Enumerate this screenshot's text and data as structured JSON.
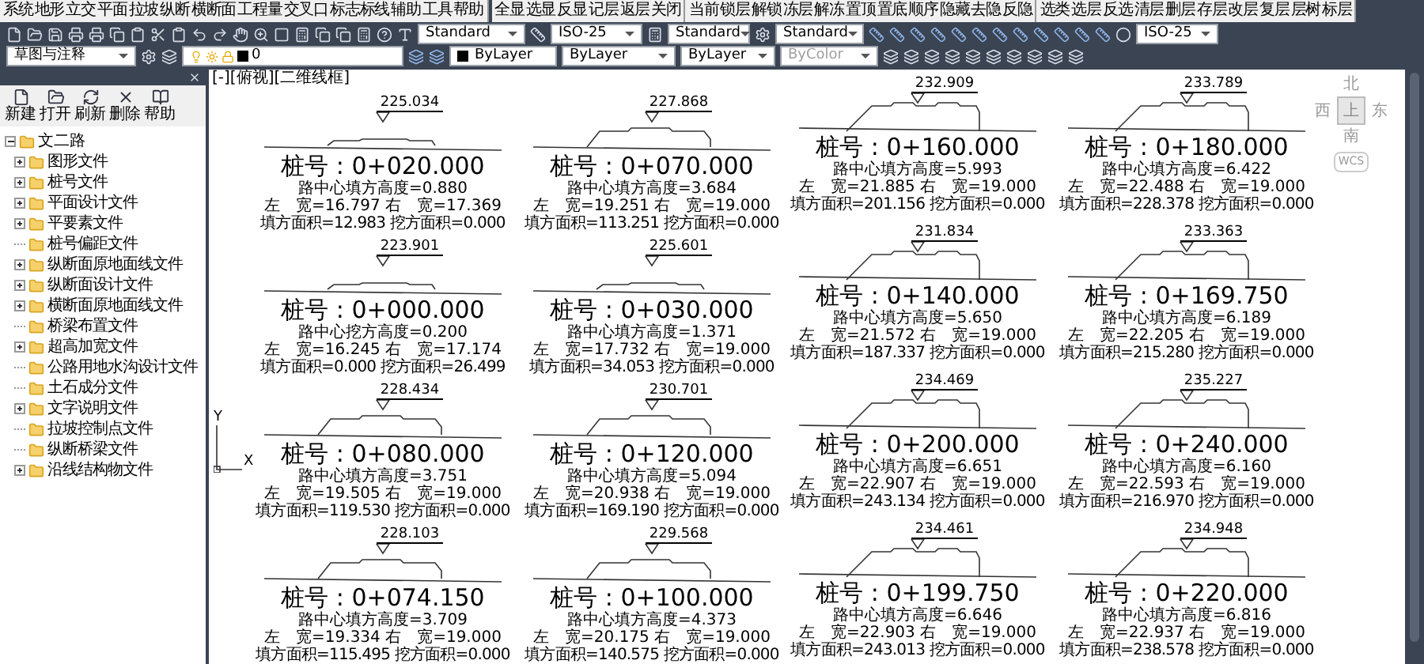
{
  "menu_groups": [
    [
      "系统",
      "地形",
      "立交",
      "平面",
      "拉坡",
      "纵断",
      "横断面",
      "工程量",
      "交叉口",
      "标志标线",
      "辅助",
      "工具",
      "帮助"
    ],
    [
      "全显",
      "选显",
      "反显",
      "记层",
      "返层",
      "关闭"
    ],
    [
      "当前",
      "锁层",
      "解锁",
      "冻层",
      "解冻",
      "置顶",
      "置底",
      "顺序",
      "隐藏",
      "去隐",
      "反隐"
    ],
    [
      "选类",
      "选层",
      "反选",
      "清层",
      "删层",
      "存层",
      "改层",
      "复层",
      "层树",
      "标层"
    ]
  ],
  "style_dropdowns": [
    "Standard",
    "ISO-25",
    "Standard",
    "Standard"
  ],
  "dim_dropdown": "ISO-25",
  "properties": {
    "workspace": "草图与注释",
    "layer": "0",
    "color_setting": "ByLayer",
    "linetype": "ByLayer",
    "lineweight": "ByLayer",
    "plot_style": "ByColor",
    "plot_style_disabled": true
  },
  "panel": {
    "tools": [
      "新建",
      "打开",
      "刷新",
      "删除",
      "帮助"
    ],
    "tree": {
      "label": "文二路",
      "expanded": true,
      "children": [
        {
          "label": "图形文件",
          "expandable": true
        },
        {
          "label": "桩号文件",
          "expandable": true
        },
        {
          "label": "平面设计文件",
          "expandable": true
        },
        {
          "label": "平要素文件",
          "expandable": true
        },
        {
          "label": "桩号偏距文件",
          "expandable": false
        },
        {
          "label": "纵断面原地面线文件",
          "expandable": true
        },
        {
          "label": "纵断面设计文件",
          "expandable": true
        },
        {
          "label": "横断面原地面线文件",
          "expandable": true
        },
        {
          "label": "桥梁布置文件",
          "expandable": false
        },
        {
          "label": "超高加宽文件",
          "expandable": true
        },
        {
          "label": "公路用地水沟设计文件",
          "expandable": false
        },
        {
          "label": "土石成分文件",
          "expandable": false
        },
        {
          "label": "文字说明文件",
          "expandable": true
        },
        {
          "label": "拉坡控制点文件",
          "expandable": false
        },
        {
          "label": "纵断桥梁文件",
          "expandable": false
        },
        {
          "label": "沿线结构物文件",
          "expandable": true
        }
      ]
    }
  },
  "viewport": {
    "label": "[-][俯视][二维线框]",
    "compass": {
      "north": "北",
      "west": "西",
      "east": "东",
      "south": "南",
      "top": "上",
      "wcs": "WCS"
    },
    "ucs": {
      "y": "Y",
      "x": "X"
    }
  },
  "section_groups": [
    {
      "sections": [
        {
          "kind": "low",
          "elevation": "225.034",
          "station": "桩号 : 0+020.000",
          "height": "路中心填方高度=0.880",
          "widths": "左　宽=16.797 右　宽=17.369",
          "areas": "填方面积=12.983  挖方面积=0.000"
        },
        {
          "kind": "mid",
          "elevation": "227.868",
          "station": "桩号 : 0+070.000",
          "height": "路中心填方高度=3.684",
          "widths": "左　宽=19.251 右　宽=19.000",
          "areas": "填方面积=113.251  挖方面积=0.000"
        },
        {
          "kind": "low",
          "elevation": "223.901",
          "station": "桩号 : 0+000.000",
          "height": "路中心挖方高度=0.200",
          "widths": "左　宽=16.245 右　宽=17.174",
          "areas": "填方面积=0.000  挖方面积=26.499"
        },
        {
          "kind": "low",
          "elevation": "225.601",
          "station": "桩号 : 0+030.000",
          "height": "路中心填方高度=1.371",
          "widths": "左　宽=17.732 右　宽=19.000",
          "areas": "填方面积=34.053  挖方面积=0.000"
        },
        {
          "kind": "mid",
          "elevation": "228.434",
          "station": "桩号 : 0+080.000",
          "height": "路中心填方高度=3.751",
          "widths": "左　宽=19.505 右　宽=19.000",
          "areas": "填方面积=119.530  挖方面积=0.000"
        },
        {
          "kind": "mid",
          "elevation": "230.701",
          "station": "桩号 : 0+120.000",
          "height": "路中心填方高度=5.094",
          "widths": "左　宽=20.938 右　宽=19.000",
          "areas": "填方面积=169.190  挖方面积=0.000"
        },
        {
          "kind": "mid",
          "elevation": "228.103",
          "station": "桩号 : 0+074.150",
          "height": "路中心填方高度=3.709",
          "widths": "左　宽=19.334 右　宽=19.000",
          "areas": "填方面积=115.495  挖方面积=0.000"
        },
        {
          "kind": "mid",
          "elevation": "229.568",
          "station": "桩号 : 0+100.000",
          "height": "路中心填方高度=4.373",
          "widths": "左　宽=20.175 右　宽=19.000",
          "areas": "填方面积=140.575  挖方面积=0.000"
        }
      ]
    },
    {
      "sections": [
        {
          "kind": "high",
          "elevation": "232.909",
          "station": "桩号 : 0+160.000",
          "height": "路中心填方高度=5.993",
          "widths": "左　宽=21.885 右　宽=19.000",
          "areas": "填方面积=201.156  挖方面积=0.000"
        },
        {
          "kind": "high",
          "elevation": "233.789",
          "station": "桩号 : 0+180.000",
          "height": "路中心填方高度=6.422",
          "widths": "左　宽=22.488 右　宽=19.000",
          "areas": "填方面积=228.378  挖方面积=0.000"
        },
        {
          "kind": "high",
          "elevation": "231.834",
          "station": "桩号 : 0+140.000",
          "height": "路中心填方高度=5.650",
          "widths": "左　宽=21.572 右　宽=19.000",
          "areas": "填方面积=187.337  挖方面积=0.000"
        },
        {
          "kind": "high",
          "elevation": "233.363",
          "station": "桩号 : 0+169.750",
          "height": "路中心填方高度=6.189",
          "widths": "左　宽=22.205 右　宽=19.000",
          "areas": "填方面积=215.280  挖方面积=0.000"
        },
        {
          "kind": "high",
          "elevation": "234.469",
          "station": "桩号 : 0+200.000",
          "height": "路中心填方高度=6.651",
          "widths": "左　宽=22.907 右　宽=19.000",
          "areas": "填方面积=243.134  挖方面积=0.000"
        },
        {
          "kind": "high",
          "elevation": "235.227",
          "station": "桩号 : 0+240.000",
          "height": "路中心填方高度=6.160",
          "widths": "左　宽=22.593 右　宽=19.000",
          "areas": "填方面积=216.970  挖方面积=0.000"
        },
        {
          "kind": "high",
          "elevation": "234.461",
          "station": "桩号 : 0+199.750",
          "height": "路中心填方高度=6.646",
          "widths": "左　宽=22.903 右　宽=19.000",
          "areas": "填方面积=243.013  挖方面积=0.000"
        },
        {
          "kind": "high",
          "elevation": "234.948",
          "station": "桩号 : 0+220.000",
          "height": "路中心填方高度=6.816",
          "widths": "左　宽=22.937 右　宽=19.000",
          "areas": "填方面积=238.578  挖方面积=0.000"
        }
      ]
    }
  ]
}
